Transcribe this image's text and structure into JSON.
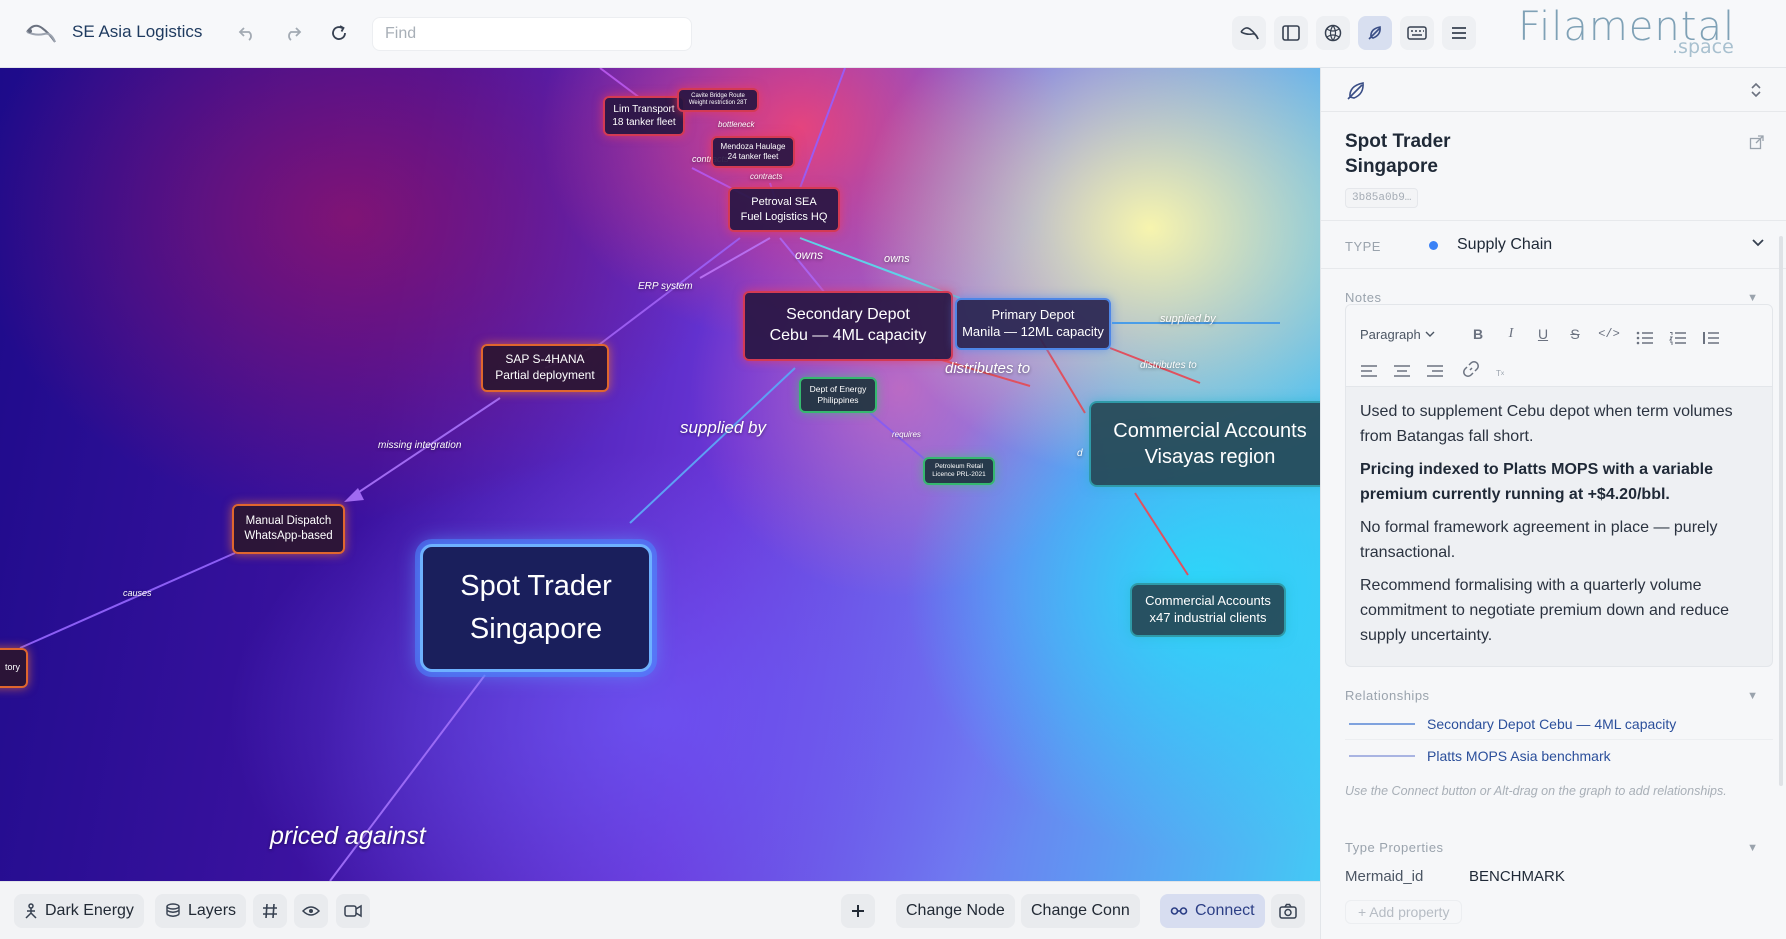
{
  "app": {
    "title": "SE Asia Logistics",
    "find_placeholder": "Find"
  },
  "brand": {
    "name": "Filamental",
    "sub": ".space"
  },
  "toolbar_icons": [
    "undo-icon",
    "redo-icon",
    "refresh-icon",
    "tree-logo-icon",
    "sidebar-toggle-icon",
    "globe-icon",
    "feather-icon",
    "keyboard-icon",
    "menu-icon"
  ],
  "nodes": [
    {
      "id": "lim",
      "lines": [
        "Lim Transport",
        "18 tanker fleet"
      ]
    },
    {
      "id": "cavite",
      "lines": [
        "Cavite Bridge Route",
        "Weight restriction 28T"
      ]
    },
    {
      "id": "mendoza",
      "lines": [
        "Mendoza Haulage",
        "24 tanker fleet"
      ]
    },
    {
      "id": "petroval",
      "lines": [
        "Petroval SEA",
        "Fuel Logistics HQ"
      ]
    },
    {
      "id": "secondary",
      "lines": [
        "Secondary Depot",
        "Cebu — 4ML capacity"
      ]
    },
    {
      "id": "primary",
      "lines": [
        "Primary Depot",
        "Manila — 12ML capacity"
      ]
    },
    {
      "id": "sap",
      "lines": [
        "SAP S-4HANA",
        "Partial deployment"
      ]
    },
    {
      "id": "doe",
      "lines": [
        "Dept of Energy",
        "Philippines"
      ]
    },
    {
      "id": "licence",
      "lines": [
        "Petroleum Retail",
        "Licence PRL-2021"
      ]
    },
    {
      "id": "visayas",
      "lines": [
        "Commercial Accounts",
        "Visayas region"
      ]
    },
    {
      "id": "dispatch",
      "lines": [
        "Manual Dispatch",
        "WhatsApp-based"
      ]
    },
    {
      "id": "spot",
      "lines": [
        "Spot Trader",
        "Singapore"
      ]
    },
    {
      "id": "industrial",
      "lines": [
        "Commercial Accounts",
        "x47 industrial clients"
      ]
    },
    {
      "id": "tory",
      "lines": [
        "tory"
      ]
    }
  ],
  "edge_labels": [
    "bottleneck",
    "contracts",
    "contracts",
    "owns",
    "owns",
    "ERP system",
    "supplied by",
    "distributes to",
    "distributes to",
    "missing integration",
    "supplied by",
    "requires",
    "causes",
    "priced against",
    "d"
  ],
  "bottom": {
    "theme": "Dark Energy",
    "layers": "Layers",
    "change_node": "Change Node",
    "change_conn": "Change Conn",
    "connect": "Connect"
  },
  "panel": {
    "title_lines": [
      "Spot Trader",
      "Singapore"
    ],
    "node_id": "3b85a0b9…",
    "type_label": "TYPE",
    "type_value": "Supply Chain",
    "type_color": "#3b82f6",
    "notes_label": "Notes",
    "paragraph_style": "Paragraph",
    "notes": [
      {
        "text": "Used to supplement Cebu depot when term volumes from Batangas fall short.",
        "bold": false
      },
      {
        "text": "Pricing indexed to Platts MOPS with a variable premium currently running at +$4.20/bbl.",
        "bold": true
      },
      {
        "text": "No formal framework agreement in place — purely transactional.",
        "bold": false
      },
      {
        "text": "Recommend formalising with a quarterly volume commitment to negotiate premium down and reduce supply uncertainty.",
        "bold": false
      }
    ],
    "relationships_label": "Relationships",
    "relationships": [
      "Secondary Depot Cebu — 4ML capacity",
      "Platts MOPS Asia benchmark"
    ],
    "hint": "Use the Connect button or Alt-drag on the graph to add relationships.",
    "type_props_label": "Type Properties",
    "props": [
      {
        "key": "Mermaid_id",
        "value": "BENCHMARK"
      }
    ],
    "add_property": "+ Add property"
  }
}
